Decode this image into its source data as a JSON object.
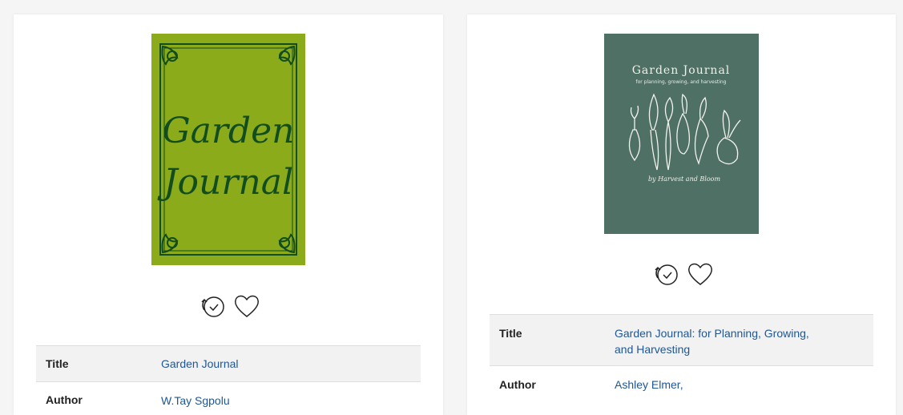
{
  "results": [
    {
      "cover_title_line1": "Garden",
      "cover_title_line2": "Journal",
      "cover_color": "#8bab1a",
      "cover_ink": "#124d1f",
      "fields": [
        {
          "label": "Title",
          "value": "Garden Journal"
        },
        {
          "label": "Author",
          "value": "W.Tay Sgpolu"
        }
      ]
    },
    {
      "cover_title": "Garden Journal",
      "cover_subtitle": "for planning, growing, and harvesting",
      "cover_author": "by Harvest and Bloom",
      "cover_color": "#4f7065",
      "fields": [
        {
          "label": "Title",
          "value": "Garden Journal: for Planning, Growing, and Harvesting"
        },
        {
          "label": "Author",
          "value": "Ashley Elmer,"
        }
      ]
    }
  ],
  "icons": {
    "recent": "history-clock-icon",
    "favorite": "heart-icon"
  },
  "colors": {
    "link": "#1f5694",
    "row_shade": "#f2f2f2"
  }
}
